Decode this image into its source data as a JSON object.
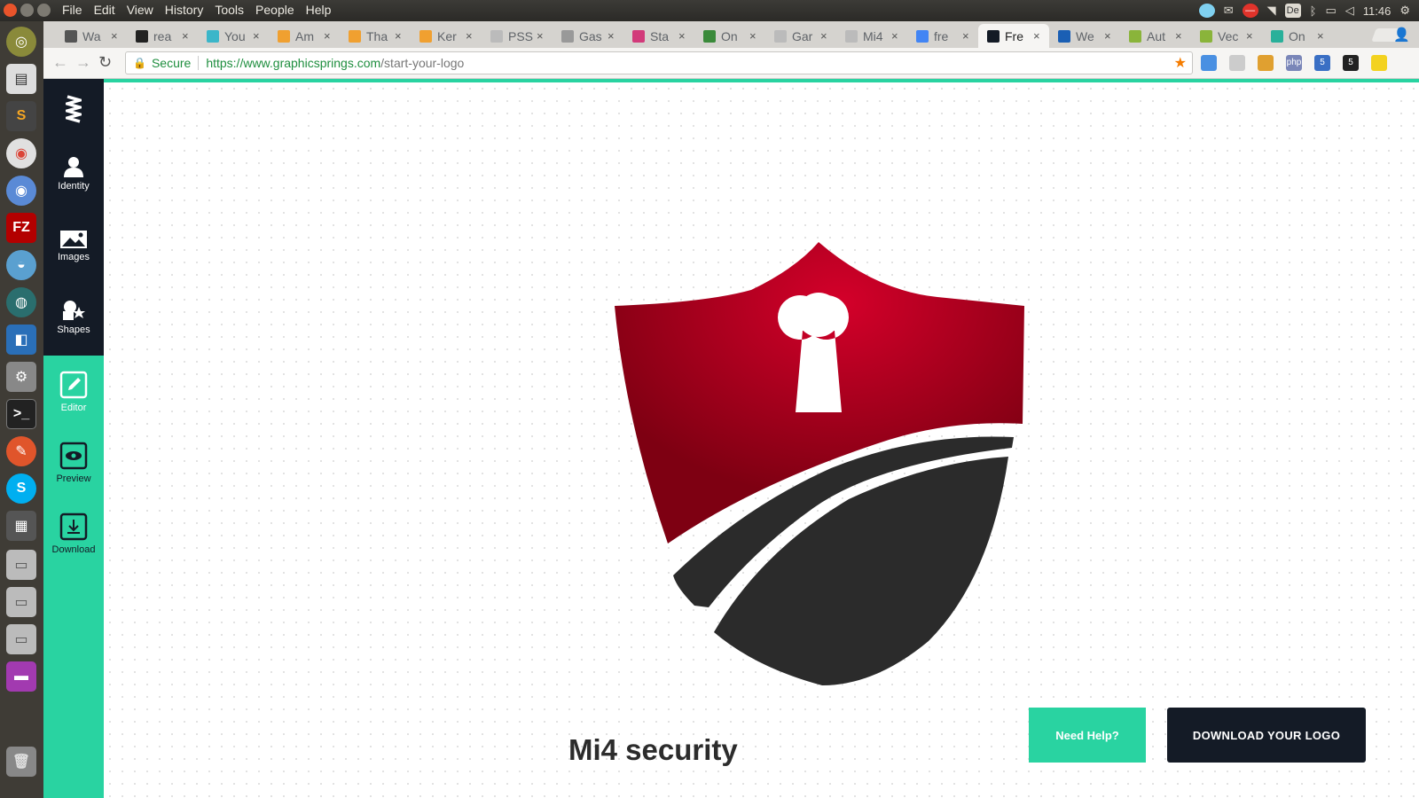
{
  "menubar": {
    "menus": [
      "File",
      "Edit",
      "View",
      "History",
      "Tools",
      "People",
      "Help"
    ],
    "keyboard_layout": "De",
    "clock": "11:46"
  },
  "tabs": [
    {
      "label": "Wa",
      "fav_color": "#555555"
    },
    {
      "label": "rea",
      "fav_color": "#222222"
    },
    {
      "label": "You",
      "fav_color": "#3bb6c9"
    },
    {
      "label": "Am",
      "fav_color": "#f0a030"
    },
    {
      "label": "Tha",
      "fav_color": "#f0a030"
    },
    {
      "label": "Ker",
      "fav_color": "#f0a030"
    },
    {
      "label": "PSS",
      "fav_color": "#bbbbbb"
    },
    {
      "label": "Gas",
      "fav_color": "#999999"
    },
    {
      "label": "Sta",
      "fav_color": "#d23a7a"
    },
    {
      "label": "On",
      "fav_color": "#3a8a3a"
    },
    {
      "label": "Gar",
      "fav_color": "#bbbbbb"
    },
    {
      "label": "Mi4",
      "fav_color": "#bbbbbb"
    },
    {
      "label": "fre",
      "fav_color": "#4285f4"
    },
    {
      "label": "Fre",
      "fav_color": "#141b26",
      "active": true
    },
    {
      "label": "We",
      "fav_color": "#1a5fb4"
    },
    {
      "label": "Aut",
      "fav_color": "#8ab43a"
    },
    {
      "label": "Vec",
      "fav_color": "#8ab43a"
    },
    {
      "label": "On",
      "fav_color": "#29b09a"
    }
  ],
  "address": {
    "secure_label": "Secure",
    "url_host": "https://www.graphicsprings.com",
    "url_path": "/start-your-logo"
  },
  "extensions": [
    {
      "icon": "layers-icon",
      "text": "",
      "color": "#4a90e2"
    },
    {
      "icon": "grid-icon",
      "text": "",
      "color": "#cccccc"
    },
    {
      "icon": "ruler-icon",
      "text": "",
      "color": "#e0a030"
    },
    {
      "icon": "php-icon",
      "text": "php",
      "color": "#7a86b8"
    },
    {
      "icon": "notification-icon",
      "text": "5",
      "color": "#3a6fc4"
    },
    {
      "icon": "amazon-icon",
      "text": "5",
      "color": "#222222"
    },
    {
      "icon": "smile-icon",
      "text": "",
      "color": "#f3d21f"
    }
  ],
  "sidebar": {
    "items": [
      {
        "label": "Identity",
        "icon": "person-icon"
      },
      {
        "label": "Images",
        "icon": "image-icon"
      },
      {
        "label": "Shapes",
        "icon": "shapes-icon"
      },
      {
        "label": "Editor",
        "icon": "edit-icon"
      },
      {
        "label": "Preview",
        "icon": "eye-icon"
      },
      {
        "label": "Download",
        "icon": "download-icon"
      }
    ]
  },
  "logo": {
    "shield_red": "#c0001f",
    "shield_dark": "#2b2b2b",
    "brand_name": "Mi4 security"
  },
  "actions": {
    "help_label": "Need Help?",
    "download_label": "DOWNLOAD YOUR LOGO"
  },
  "colors": {
    "accent": "#29d3a1",
    "dark": "#141b26"
  }
}
